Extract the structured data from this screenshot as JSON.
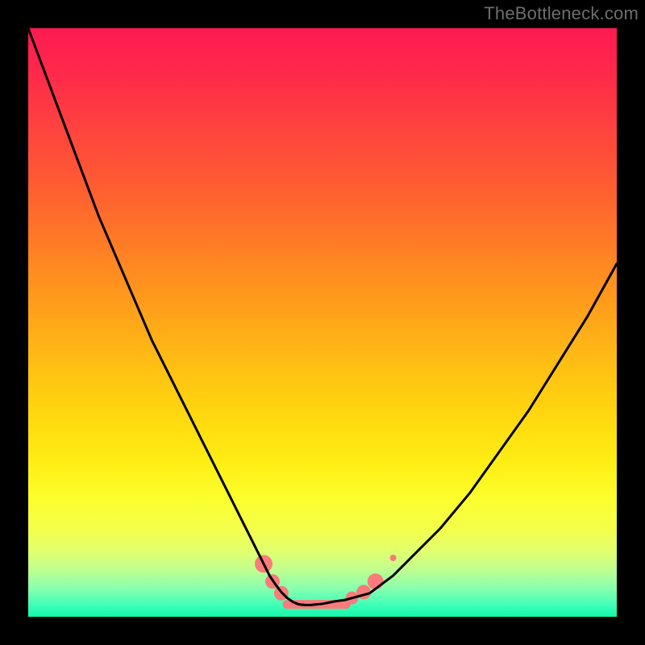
{
  "brand": {
    "watermark": "TheBottleneck.com"
  },
  "chart_data": {
    "type": "line",
    "title": "",
    "xlabel": "",
    "ylabel": "",
    "xlim": [
      0,
      100
    ],
    "ylim": [
      0,
      100
    ],
    "grid": false,
    "legend": false,
    "series": [
      {
        "name": "bottleneck-curve",
        "color": "#000000",
        "x": [
          0,
          3,
          6,
          9,
          12,
          15,
          18,
          21,
          24,
          27,
          30,
          33,
          36,
          38,
          39,
          40,
          41,
          42,
          43,
          44,
          45,
          46,
          47,
          48,
          49,
          50,
          51,
          52,
          54,
          58,
          62,
          66,
          70,
          75,
          80,
          85,
          90,
          95,
          100
        ],
        "y": [
          100,
          92,
          84,
          76,
          68,
          61,
          54,
          47,
          41,
          35,
          29,
          23,
          17,
          13,
          11,
          9,
          7,
          5.5,
          4.2,
          3.2,
          2.5,
          2.1,
          2.0,
          2.0,
          2.1,
          2.2,
          2.4,
          2.6,
          2.9,
          4.0,
          7,
          11,
          15,
          21,
          28,
          35,
          43,
          51,
          60
        ]
      }
    ],
    "markers": [
      {
        "name": "left-marker-upper",
        "x": 40,
        "y": 9,
        "color": "#f97b7b",
        "r": 11
      },
      {
        "name": "left-marker-mid",
        "x": 41.5,
        "y": 6,
        "color": "#f97b7b",
        "r": 9
      },
      {
        "name": "left-marker-low",
        "x": 43,
        "y": 4,
        "color": "#f97b7b",
        "r": 9
      },
      {
        "name": "right-marker-low",
        "x": 55,
        "y": 3.2,
        "color": "#f97b7b",
        "r": 8
      },
      {
        "name": "right-marker-mid",
        "x": 57,
        "y": 4.2,
        "color": "#f97b7b",
        "r": 9
      },
      {
        "name": "right-marker-upper",
        "x": 59,
        "y": 6,
        "color": "#f97b7b",
        "r": 10
      },
      {
        "name": "right-lone-dot",
        "x": 62,
        "y": 10,
        "color": "#f97b7b",
        "r": 4
      }
    ],
    "trough_band": {
      "x_start": 44,
      "x_end": 54,
      "y": 2.1,
      "color": "#f97b7b",
      "thickness": 11
    }
  }
}
